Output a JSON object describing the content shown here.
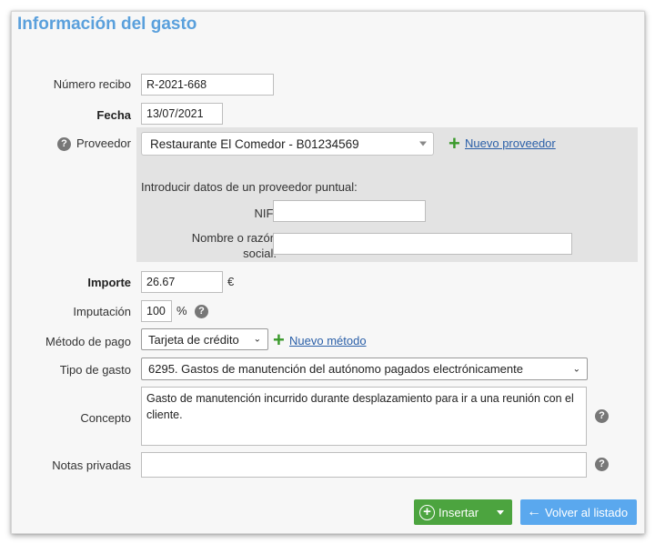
{
  "form": {
    "title": "Información del gasto",
    "receipt_number": {
      "label": "Número recibo",
      "value": "R-2021-668"
    },
    "date": {
      "label": "Fecha",
      "value": "13/07/2021"
    },
    "supplier": {
      "label": "Proveedor",
      "selected": "Restaurante El Comedor - B01234569",
      "new_link": "Nuevo proveedor",
      "one_off_heading": "Introducir datos de un proveedor puntual:",
      "nif_label": "NIF:",
      "nif_value": "",
      "name_label_line1": "Nombre o razón",
      "name_label_line2": "social:",
      "name_value": ""
    },
    "amount": {
      "label": "Importe",
      "value": "26.67",
      "currency": "€"
    },
    "allocation": {
      "label": "Imputación",
      "value": "100",
      "unit": "%"
    },
    "payment_method": {
      "label": "Método de pago",
      "selected": "Tarjeta de crédito",
      "new_link": "Nuevo método"
    },
    "expense_type": {
      "label": "Tipo de gasto",
      "selected": "6295. Gastos de manutención del autónomo pagados electrónicamente"
    },
    "concept": {
      "label": "Concepto",
      "value": "Gasto de manutención incurrido durante desplazamiento para ir a una reunión con el cliente."
    },
    "private_notes": {
      "label": "Notas privadas",
      "value": ""
    },
    "help_glyph": "?"
  },
  "actions": {
    "insert_label": "Insertar",
    "back_label": "Volver al listado"
  },
  "icons": {
    "help": "help-circle-icon",
    "add": "plus-icon",
    "caret": "chevron-down-icon",
    "back": "arrow-left-icon",
    "insert": "plus-circle-icon"
  },
  "colors": {
    "title": "#5aa0dc",
    "insert_button": "#4ca43f",
    "back_button": "#5aa8ee",
    "add_icon": "#3a9a2b",
    "link": "#2a5fa8"
  }
}
